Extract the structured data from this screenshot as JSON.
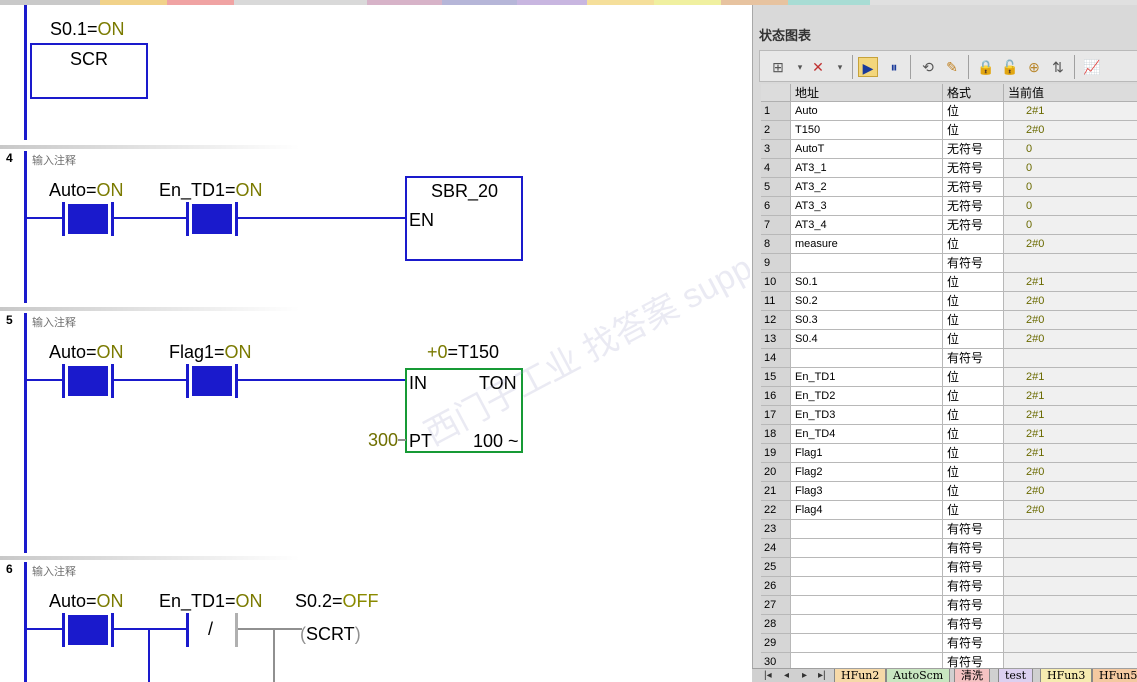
{
  "ladder": {
    "scr_label_name": "S0.1=",
    "scr_label_state": "ON",
    "scr_box": "SCR",
    "networks": [
      {
        "num": "4",
        "comment": "输入注释"
      },
      {
        "num": "5",
        "comment": "输入注释"
      },
      {
        "num": "6",
        "comment": "输入注释"
      }
    ],
    "n4": {
      "c1_name": "Auto=",
      "c1_state": "ON",
      "c2_name": "En_TD1=",
      "c2_state": "ON",
      "box_title": "SBR_20",
      "box_en": "EN"
    },
    "n5": {
      "c1_name": "Auto=",
      "c1_state": "ON",
      "c2_name": "Flag1=",
      "c2_state": "ON",
      "timer_val": "+0",
      "timer_name": "=T150",
      "in": "IN",
      "ton": "TON",
      "pt_value": "300",
      "pt": "PT",
      "base": "100 ~"
    },
    "n6": {
      "c1_name": "Auto=",
      "c1_state": "ON",
      "c2_name": "En_TD1=",
      "c2_state": "ON",
      "c3_name": "S0.2=",
      "c3_state": "OFF",
      "not_symbol": "/",
      "coil": "SCRT"
    }
  },
  "status_chart": {
    "title": "状态图表",
    "headers": {
      "address": "地址",
      "format": "格式",
      "current": "当前值"
    },
    "rows": [
      {
        "n": "1",
        "addr": "Auto",
        "fmt": "位",
        "val": "2#1"
      },
      {
        "n": "2",
        "addr": "T150",
        "fmt": "位",
        "val": "2#0"
      },
      {
        "n": "3",
        "addr": "AutoT",
        "fmt": "无符号",
        "val": "0"
      },
      {
        "n": "4",
        "addr": "AT3_1",
        "fmt": "无符号",
        "val": "0"
      },
      {
        "n": "5",
        "addr": "AT3_2",
        "fmt": "无符号",
        "val": "0"
      },
      {
        "n": "6",
        "addr": "AT3_3",
        "fmt": "无符号",
        "val": "0"
      },
      {
        "n": "7",
        "addr": "AT3_4",
        "fmt": "无符号",
        "val": "0"
      },
      {
        "n": "8",
        "addr": "measure",
        "fmt": "位",
        "val": "2#0"
      },
      {
        "n": "9",
        "addr": "",
        "fmt": "有符号",
        "val": ""
      },
      {
        "n": "10",
        "addr": "S0.1",
        "fmt": "位",
        "val": "2#1"
      },
      {
        "n": "11",
        "addr": "S0.2",
        "fmt": "位",
        "val": "2#0"
      },
      {
        "n": "12",
        "addr": "S0.3",
        "fmt": "位",
        "val": "2#0"
      },
      {
        "n": "13",
        "addr": "S0.4",
        "fmt": "位",
        "val": "2#0"
      },
      {
        "n": "14",
        "addr": "",
        "fmt": "有符号",
        "val": ""
      },
      {
        "n": "15",
        "addr": "En_TD1",
        "fmt": "位",
        "val": "2#1"
      },
      {
        "n": "16",
        "addr": "En_TD2",
        "fmt": "位",
        "val": "2#1"
      },
      {
        "n": "17",
        "addr": "En_TD3",
        "fmt": "位",
        "val": "2#1"
      },
      {
        "n": "18",
        "addr": "En_TD4",
        "fmt": "位",
        "val": "2#1"
      },
      {
        "n": "19",
        "addr": "Flag1",
        "fmt": "位",
        "val": "2#1"
      },
      {
        "n": "20",
        "addr": "Flag2",
        "fmt": "位",
        "val": "2#0"
      },
      {
        "n": "21",
        "addr": "Flag3",
        "fmt": "位",
        "val": "2#0"
      },
      {
        "n": "22",
        "addr": "Flag4",
        "fmt": "位",
        "val": "2#0"
      },
      {
        "n": "23",
        "addr": "",
        "fmt": "有符号",
        "val": ""
      },
      {
        "n": "24",
        "addr": "",
        "fmt": "有符号",
        "val": ""
      },
      {
        "n": "25",
        "addr": "",
        "fmt": "有符号",
        "val": ""
      },
      {
        "n": "26",
        "addr": "",
        "fmt": "有符号",
        "val": ""
      },
      {
        "n": "27",
        "addr": "",
        "fmt": "有符号",
        "val": ""
      },
      {
        "n": "28",
        "addr": "",
        "fmt": "有符号",
        "val": ""
      },
      {
        "n": "29",
        "addr": "",
        "fmt": "有符号",
        "val": ""
      },
      {
        "n": "30",
        "addr": "",
        "fmt": "有符号",
        "val": ""
      }
    ],
    "tabs": [
      {
        "label": "HFun2",
        "color": "#f6d9a8"
      },
      {
        "label": "AutoScm",
        "color": "#c8e6c0"
      },
      {
        "label": "清洗",
        "color": "#f4c2c2"
      },
      {
        "label": "test",
        "color": "#dcd0f0"
      },
      {
        "label": "HFun3",
        "color": "#f6ecb0"
      },
      {
        "label": "HFun5",
        "color": "#f4c9a0"
      }
    ]
  },
  "watermark": "西门子工业 找答案 support.industry.siemens.com/cs",
  "colors": {
    "rail": "#1a1acc",
    "on_state": "#7a7a00",
    "timer_box": "#169a35"
  }
}
